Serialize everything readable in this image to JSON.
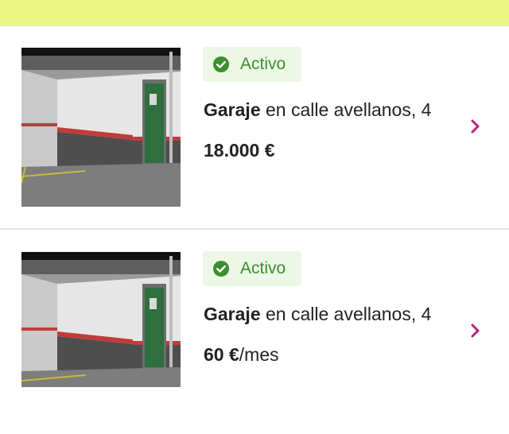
{
  "colors": {
    "topbar": "#eaf684",
    "accent": "#b3247c",
    "status_green": "#3c8f2e",
    "status_bg": "#ecf7e6"
  },
  "listings": [
    {
      "image": "garage-photo",
      "status": "Activo",
      "type": "Garaje",
      "title_rest": " en calle avellanos, 4",
      "price_main": "18.000 €",
      "price_suffix": ""
    },
    {
      "image": "garage-photo",
      "status": "Activo",
      "type": "Garaje",
      "title_rest": " en calle avellanos, 4",
      "price_main": "60 €",
      "price_suffix": "/mes"
    }
  ],
  "icons": {
    "status": "check-circle-icon",
    "navigate": "chevron-right-icon"
  }
}
